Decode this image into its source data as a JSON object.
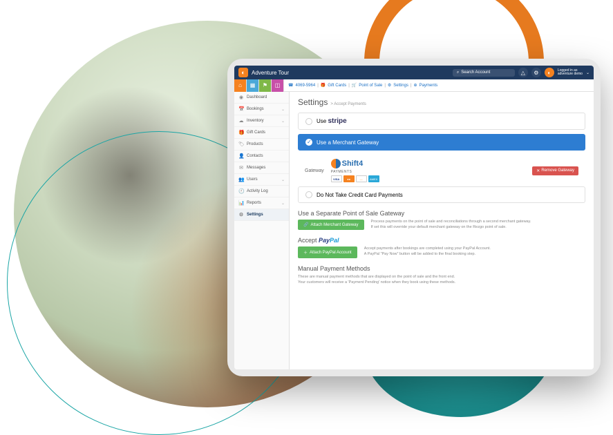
{
  "header": {
    "title": "Adventure Tour",
    "search_placeholder": "Search Account",
    "login_line1": "Logged in as",
    "login_line2": "adventure demo"
  },
  "crumbs": {
    "c1": "4069-5964",
    "c2": "Gift Cards",
    "c3": "Point of Sale",
    "c4": "Settings",
    "c5": "Payments"
  },
  "sidebar": {
    "items": [
      {
        "icon": "◉",
        "label": "Dashboard",
        "expandable": false
      },
      {
        "icon": "📅",
        "label": "Bookings",
        "expandable": true
      },
      {
        "icon": "☁",
        "label": "Inventory",
        "expandable": true
      },
      {
        "icon": "🎁",
        "label": "Gift Cards",
        "expandable": false
      },
      {
        "icon": "🏷",
        "label": "Products",
        "expandable": false
      },
      {
        "icon": "👤",
        "label": "Contacts",
        "expandable": false
      },
      {
        "icon": "✉",
        "label": "Messages",
        "expandable": false
      },
      {
        "icon": "👥",
        "label": "Users",
        "expandable": true
      },
      {
        "icon": "🕘",
        "label": "Activity Log",
        "expandable": false
      },
      {
        "icon": "📊",
        "label": "Reports",
        "expandable": true
      },
      {
        "icon": "⚙",
        "label": "Settings",
        "expandable": false
      }
    ]
  },
  "main": {
    "title": "Settings",
    "subtitle": "> Accept Payments",
    "opt_stripe_prefix": "Use",
    "opt_stripe_brand": "stripe",
    "opt_gateway": "Use a Merchant Gateway",
    "gateway_label": "Gateway",
    "shift4_name": "Shift4",
    "shift4_sub": "PAYMENTS",
    "card_visa": "VISA",
    "card_amex": "AMEX",
    "remove_gateway": "Remove Gateway",
    "opt_nocards": "Do Not Take Credit Card Payments",
    "sep_title": "Use a Separate Point of Sale Gateway",
    "sep_btn": "Attach Merchant Gateway",
    "sep_desc1": "Process payments on the point of sale and reconciliations through a second merchant gateway.",
    "sep_desc2": "If set this will override your default merchant gateway on the Rezgo point of sale.",
    "paypal_title_prefix": "Accept",
    "paypal_brand_pay": "Pay",
    "paypal_brand_pal": "Pal",
    "paypal_btn": "Attach PayPal Account",
    "paypal_desc1": "Accept payments after bookings are completed using your PayPal Account.",
    "paypal_desc2": "A PayPal \"Pay Now\" button will be added to the final booking step.",
    "manual_title": "Manual Payment Methods",
    "manual_desc1": "These are manual payment methods that are displayed on the point of sale and the front end.",
    "manual_desc2": "Your customers will receive a 'Payment Pending' notice when they book using these methods."
  }
}
